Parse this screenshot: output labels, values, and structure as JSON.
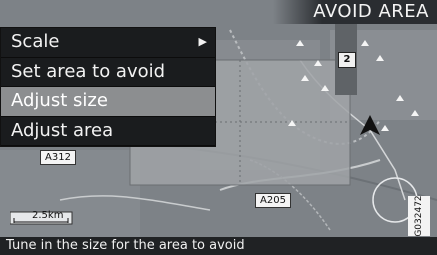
{
  "header": {
    "title": "AVOID AREA"
  },
  "menu": {
    "items": [
      {
        "label": "Scale",
        "has_submenu": true,
        "selected": false
      },
      {
        "label": "Set area to avoid",
        "has_submenu": false,
        "selected": false
      },
      {
        "label": "Adjust size",
        "has_submenu": false,
        "selected": true
      },
      {
        "label": "Adjust area",
        "has_submenu": false,
        "selected": false
      }
    ],
    "submenu_arrow_icon": "triangle-right-icon"
  },
  "status": {
    "text": "Tune in the size for the area to avoid"
  },
  "map": {
    "scale_label": "2.5km",
    "road_labels": {
      "a205": "A205",
      "a312": "A312"
    },
    "route_shield": "2"
  },
  "ref_code": "G032472",
  "colors": {
    "menu_bg": "#1a1c1e",
    "menu_selected": "#8c8e90",
    "map_bg": "#7d8287",
    "avoid_area": "#9fa2a6"
  }
}
